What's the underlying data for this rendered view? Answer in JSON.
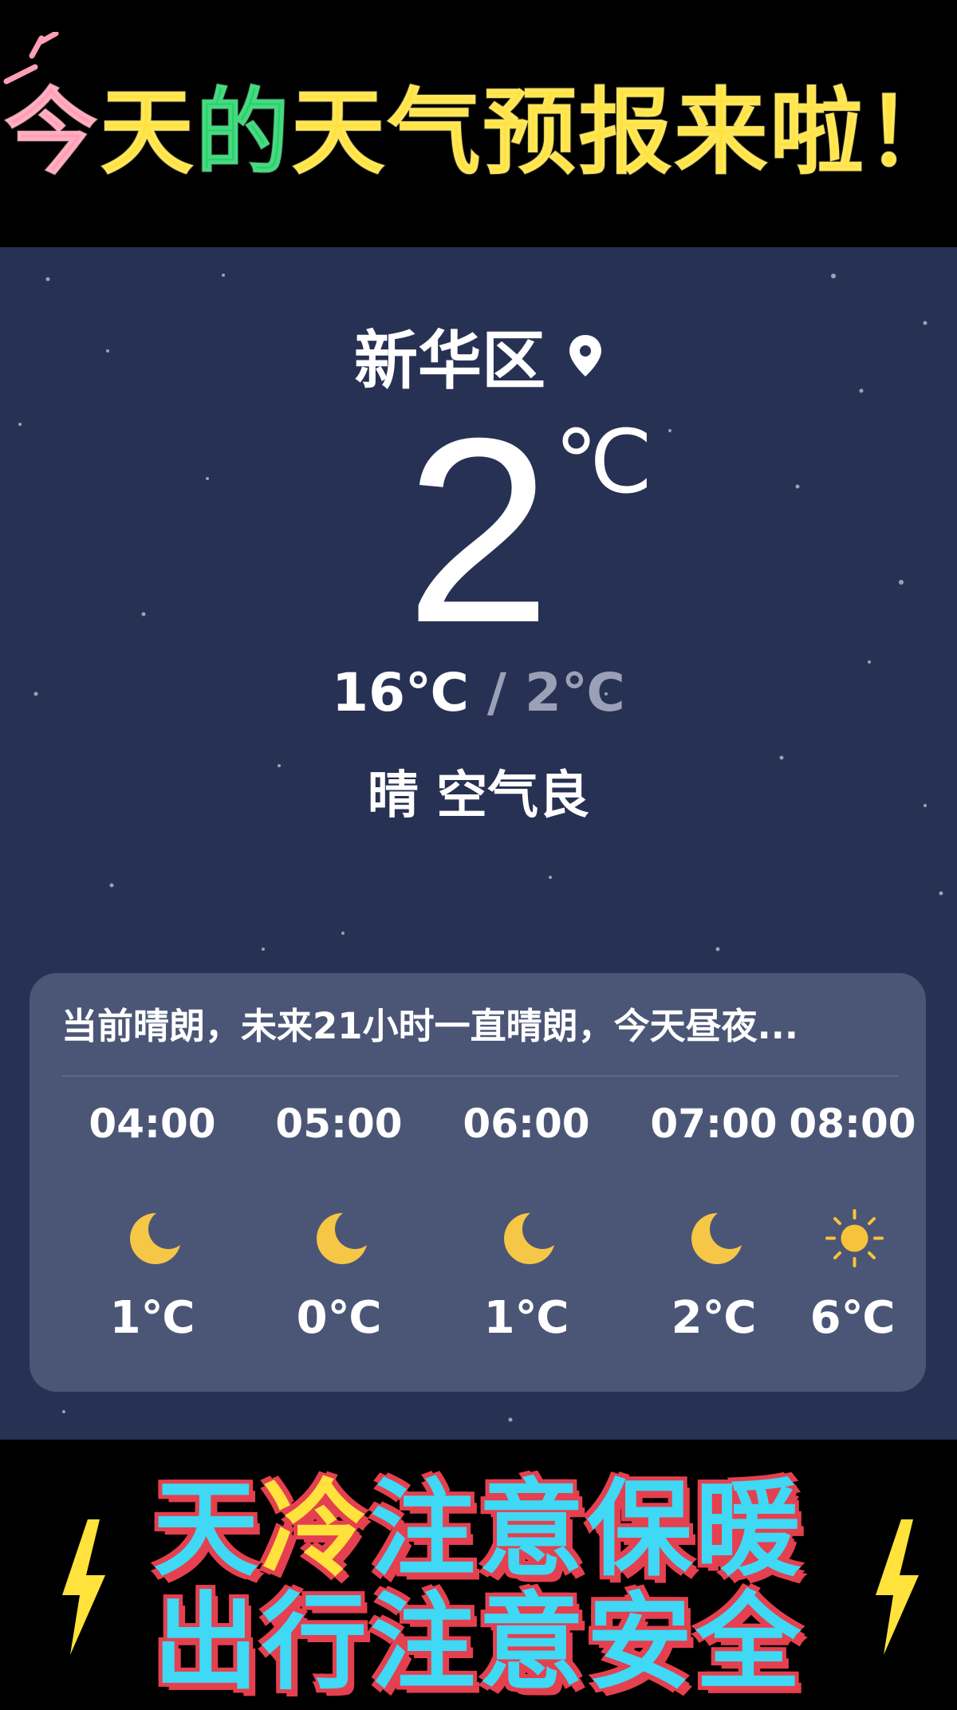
{
  "banner": {
    "headline_chars": [
      "今",
      "天",
      "的",
      "天",
      "气",
      "预",
      "报",
      "来",
      "啦",
      "！"
    ],
    "headline_colors": [
      "#ff9fb5",
      "#ffe23b",
      "#27d36b",
      "#ffe23b",
      "#ffe23b",
      "#ffe23b",
      "#ffe23b",
      "#ffe23b",
      "#ffe23b",
      "#ffe23b"
    ]
  },
  "weather": {
    "location": "新华区",
    "current_temp": "2",
    "current_unit": "℃",
    "high": "16℃",
    "separator": " / ",
    "low": "2℃",
    "condition": "晴 空气良",
    "summary": "当前晴朗，未来21小时一直晴朗，今天昼夜...",
    "hourly": [
      {
        "time": "04:00",
        "icon": "moon-icon",
        "temp": "1℃"
      },
      {
        "time": "05:00",
        "icon": "moon-icon",
        "temp": "0℃"
      },
      {
        "time": "06:00",
        "icon": "moon-icon",
        "temp": "1℃"
      },
      {
        "time": "07:00",
        "icon": "moon-icon",
        "temp": "2℃"
      },
      {
        "time": "08:00",
        "icon": "sun-icon",
        "temp": "6℃"
      }
    ]
  },
  "bottom": {
    "line1_prefix": "天",
    "line1_accent": "冷",
    "line1_suffix": "注意保暖",
    "line2": "出行注意安全"
  },
  "colors": {
    "panel_bg": "#273153",
    "card_bg": "#4b5677",
    "moon": "#f6c646",
    "sun": "#f7c33a",
    "slogan_fill": "#3fd8f5",
    "slogan_outline": "#e4404f"
  }
}
